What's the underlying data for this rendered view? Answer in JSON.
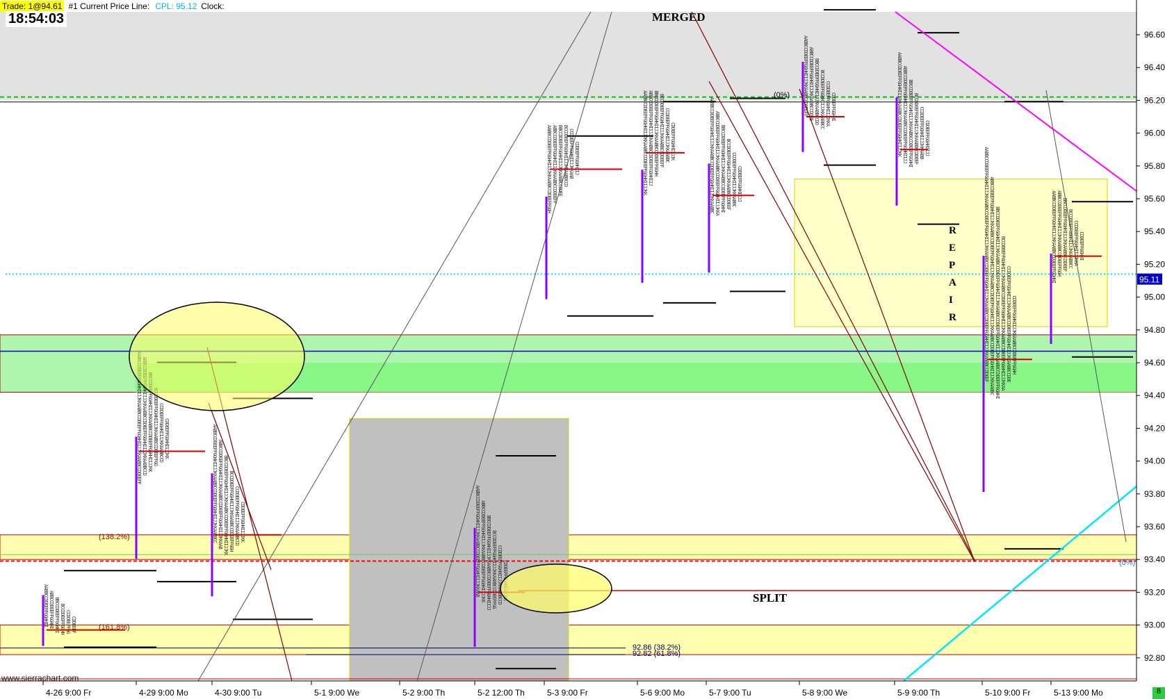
{
  "header": {
    "trade": "Trade: 1@94.61",
    "cpl_label": "#1 Current Price Line:",
    "cpl_value": "CPL: 95.12",
    "clock_label": "Clock:",
    "time": "18:54:03"
  },
  "watermark": "www.sierrachart.com",
  "corner_badge": "8",
  "colors": {
    "accent_cyan": "#00e5ff",
    "green_zone": "#66ff66",
    "yellow_zone": "#ffff99",
    "gray_zone": "#c0c0c0",
    "magenta": "#ff00ff",
    "profile_purple": "#8800ff",
    "poc_red": "#d00000"
  },
  "chart_data": {
    "type": "table",
    "ylim": [
      92.65,
      96.82
    ],
    "y_ticks": [
      92.8,
      93.0,
      93.2,
      93.4,
      93.6,
      93.8,
      94.0,
      94.2,
      94.4,
      94.6,
      94.8,
      95.0,
      95.2,
      95.4,
      95.6,
      95.8,
      96.0,
      96.2,
      96.4,
      96.6
    ],
    "y_tick_labels": [
      "92.80",
      "93.00",
      "93.20",
      "93.40",
      "93.60",
      "93.80",
      "94.00",
      "94.20",
      "94.40",
      "94.60",
      "94.80",
      "95.00",
      "95.20",
      "95.40",
      "95.60",
      "95.80",
      "96.00",
      "96.20",
      "96.40",
      "96.60"
    ],
    "x_labels": [
      "4-26  9:00 Fr",
      "4-29  9:00 Mo",
      "4-30  9:00 Tu",
      "5-1  9:00 We",
      "5-2  9:00 Th",
      "5-2  12:00 Th",
      "5-3  9:00 Fr",
      "5-6  9:00 Mo",
      "5-7  9:00 Tu",
      "5-8  9:00 We",
      "5-9  9:00 Th",
      "5-10  9:00 Fr",
      "5-13  9:00 Mo"
    ],
    "current_price": 95.11,
    "current_price_label": "95.11",
    "profiles": [
      {
        "label": "4-26",
        "low": 92.78,
        "high": 93.4,
        "poc": 92.97
      },
      {
        "label": "4-29",
        "low": 93.18,
        "high": 94.67,
        "poc": 94.06
      },
      {
        "label": "4-30",
        "low": 92.95,
        "high": 94.45,
        "poc": 93.55
      },
      {
        "label": "5-2",
        "low": 92.65,
        "high": 94.1,
        "poc": 93.2
      },
      {
        "label": "5-3",
        "low": 94.8,
        "high": 96.05,
        "poc": 95.78
      },
      {
        "label": "5-6",
        "low": 94.88,
        "high": 96.26,
        "poc": 95.88
      },
      {
        "label": "5-7",
        "low": 94.95,
        "high": 96.28,
        "poc": 95.62
      },
      {
        "label": "5-8",
        "low": 95.72,
        "high": 96.82,
        "poc": 96.1
      },
      {
        "label": "5-9",
        "low": 95.36,
        "high": 96.68,
        "poc": 95.9
      },
      {
        "label": "5-10",
        "low": 93.38,
        "high": 96.26,
        "poc": 94.62
      },
      {
        "label": "5-13",
        "low": 94.55,
        "high": 95.65,
        "poc": 95.25
      }
    ],
    "annotations": [
      "MERGED",
      "SPLIT",
      "R",
      "E",
      "P",
      "A",
      "I",
      "R"
    ],
    "fib_labels": [
      "(138.2%)",
      "(161.8%)",
      "92.86  (38.2%)",
      "92.82  (61.8%)",
      "(0%)",
      "(0%)"
    ]
  }
}
